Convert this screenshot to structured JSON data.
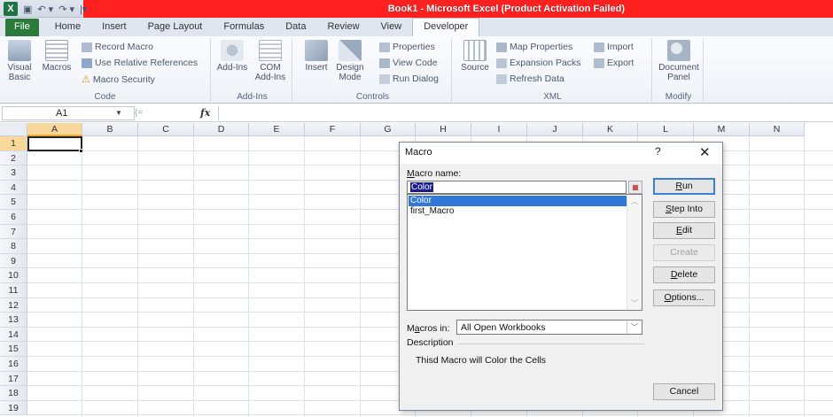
{
  "window": {
    "title": "Book1 - Microsoft Excel (Product Activation Failed)",
    "qat": {
      "logo": "X",
      "save": "▣",
      "undo": "↶ ▾",
      "redo": "↷ ▾",
      "customize": "|▾"
    }
  },
  "tabs": [
    "File",
    "Home",
    "Insert",
    "Page Layout",
    "Formulas",
    "Data",
    "Review",
    "View",
    "Developer"
  ],
  "active_tab": "Developer",
  "ribbon": {
    "code": {
      "label": "Code",
      "visual_basic": "Visual\nBasic",
      "macros": "Macros",
      "record_macro": "Record Macro",
      "relative_refs": "Use Relative References",
      "macro_security": "Macro Security"
    },
    "addins": {
      "label": "Add-Ins",
      "addins": "Add-Ins",
      "com_addins": "COM\nAdd-Ins"
    },
    "controls": {
      "label": "Controls",
      "insert": "Insert",
      "design_mode": "Design\nMode",
      "properties": "Properties",
      "view_code": "View Code",
      "run_dialog": "Run Dialog"
    },
    "xml": {
      "label": "XML",
      "source": "Source",
      "map_properties": "Map Properties",
      "expansion_packs": "Expansion Packs",
      "refresh_data": "Refresh Data",
      "import": "Import",
      "export": "Export"
    },
    "modify": {
      "label": "Modify",
      "document_panel": "Document\nPanel"
    }
  },
  "formula_bar": {
    "name_box": "A1",
    "fx": "fx",
    "value": ""
  },
  "grid": {
    "columns": [
      "A",
      "B",
      "C",
      "D",
      "E",
      "F",
      "G",
      "H",
      "I",
      "J",
      "K",
      "L",
      "M",
      "N"
    ],
    "rows": [
      "1",
      "2",
      "3",
      "4",
      "5",
      "6",
      "7",
      "8",
      "9",
      "10",
      "11",
      "12",
      "13",
      "14",
      "15",
      "16",
      "17",
      "18",
      "19"
    ],
    "active_cell": "A1"
  },
  "dialog": {
    "title": "Macro",
    "help": "?",
    "close": "✕",
    "macro_name_label_pre": "",
    "macro_name_label_key": "M",
    "macro_name_label_post": "acro name:",
    "macro_name_value": "Color",
    "macros": [
      "Color",
      "first_Macro"
    ],
    "selected_macro": "Color",
    "buttons": {
      "run": {
        "key": "R",
        "rest": "un"
      },
      "step_into": {
        "key": "S",
        "rest": "tep Into"
      },
      "edit": {
        "key": "E",
        "rest": "dit"
      },
      "create": "Create",
      "delete": {
        "key": "D",
        "rest": "elete"
      },
      "options": {
        "key": "O",
        "rest": "ptions..."
      },
      "cancel": "Cancel"
    },
    "macros_in_label_pre": "M",
    "macros_in_label_key": "a",
    "macros_in_label_post": "cros in:",
    "macros_in_value": "All Open Workbooks",
    "description_label": "Description",
    "description_text": "Thisd Macro will Color the Cells"
  }
}
